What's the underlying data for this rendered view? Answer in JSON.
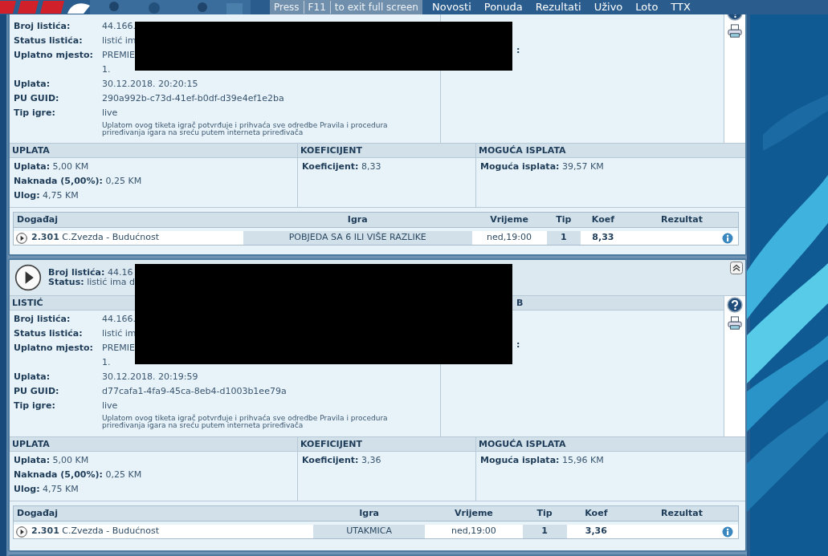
{
  "logo": {
    "kind": "brand"
  },
  "nav": {
    "menu": [
      "Novosti",
      "Ponuda",
      "Rezultati",
      "Uživo",
      "Loto",
      "TTX"
    ],
    "fullscreen_hint": [
      "Press",
      "F11",
      "to exit full screen"
    ]
  },
  "tickets": [
    {
      "redacted": true,
      "info": [
        {
          "label": "Broj listića:",
          "value": "44.166."
        },
        {
          "label": "Status listića:",
          "value": "listić im"
        },
        {
          "label": "Uplatno mjesto:",
          "value": "PREMIE"
        },
        {
          "value": "1."
        },
        {
          "label": "Uplata:",
          "value": "30.12.2018. 20:20:15"
        },
        {
          "label": "PU GUID:",
          "value": "290a992b-c73d-41ef-b0df-d39e4ef1e2ba"
        },
        {
          "label": "Tip igre:",
          "value": "live"
        }
      ],
      "disclaimer": "Uplatom ovog tiketa igrač potvrđuje i prihvaća sve odredbe Pravila i procedura priređivanja igara na sreću putem interneta priređivača",
      "right_fragment": ":",
      "sections": [
        {
          "title": "UPLATA",
          "lines": [
            {
              "label": "Uplata:",
              "value": "5,00 KM"
            },
            {
              "label": "Naknada (5,00%):",
              "value": "0,25 KM"
            },
            {
              "label": "Ulog:",
              "value": "4,75 KM"
            }
          ]
        },
        {
          "title": "KOEFICIJENT",
          "lines": [
            {
              "label": "Koeficijent:",
              "value": "8,33"
            }
          ]
        },
        {
          "title": "MOGUĆA ISPLATA",
          "lines": [
            {
              "label": "Moguća isplata:",
              "value": "39,57 KM"
            }
          ]
        }
      ],
      "events": {
        "columns": [
          "Događaj",
          "Igra",
          "Vrijeme",
          "Tip",
          "Koef",
          "Rezultat"
        ],
        "rows": [
          {
            "code": "2.301",
            "match": "C.Zvezda - Budućnost",
            "game": "POBJEDA SA 6 ILI VIŠE RAZLIKE",
            "time": "ned,19:00",
            "tip": "1",
            "odds": "8,33"
          }
        ]
      }
    },
    {
      "redacted": true,
      "header": {
        "lines": [
          {
            "label": "Broj listića:",
            "value": "44.16"
          },
          {
            "label": "Status:",
            "value": "listić ima d"
          }
        ]
      },
      "info_title": "LISTIĆ",
      "right_title_fragment": "B",
      "info": [
        {
          "label": "Broj listića:",
          "value": "44.166."
        },
        {
          "label": "Status listića:",
          "value": "listić im"
        },
        {
          "label": "Uplatno mjesto:",
          "value": "PREMIE"
        },
        {
          "value": "1."
        },
        {
          "label": "Uplata:",
          "value": "30.12.2018. 20:19:59"
        },
        {
          "label": "PU GUID:",
          "value": "d77cafa1-4fa9-45ca-8eb4-d1003b1ee79a"
        },
        {
          "label": "Tip igre:",
          "value": "live"
        }
      ],
      "disclaimer": "Uplatom ovog tiketa igrač potvrđuje i prihvaća sve odredbe Pravila i procedura priređivanja igara na sreću putem interneta priređivača",
      "right_fragment": ":",
      "sections": [
        {
          "title": "UPLATA",
          "lines": [
            {
              "label": "Uplata:",
              "value": "5,00 KM"
            },
            {
              "label": "Naknada (5,00%):",
              "value": "0,25 KM"
            },
            {
              "label": "Ulog:",
              "value": "4,75 KM"
            }
          ]
        },
        {
          "title": "KOEFICIJENT",
          "lines": [
            {
              "label": "Koeficijent:",
              "value": "3,36"
            }
          ]
        },
        {
          "title": "MOGUĆA ISPLATA",
          "lines": [
            {
              "label": "Moguća isplata:",
              "value": "15,96 KM"
            }
          ]
        }
      ],
      "events": {
        "columns": [
          "Događaj",
          "Igra",
          "Vrijeme",
          "Tip",
          "Koef",
          "Rezultat"
        ],
        "rows": [
          {
            "code": "2.301",
            "match": "C.Zvezda - Budućnost",
            "game": "UTAKMICA",
            "time": "ned,19:00",
            "tip": "1",
            "odds": "3,36"
          }
        ]
      }
    }
  ]
}
